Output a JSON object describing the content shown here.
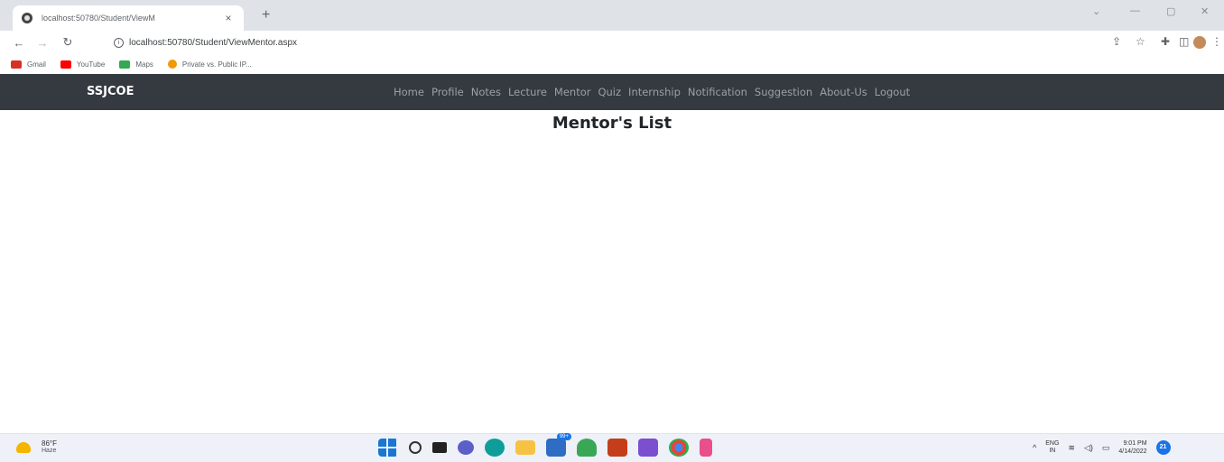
{
  "browser": {
    "tab_title": "localhost:50780/Student/ViewM",
    "tab_close": "×",
    "new_tab": "+",
    "url": "localhost:50780/Student/ViewMentor.aspx",
    "bookmarks": [
      {
        "label": "Gmail",
        "color": "#d93025"
      },
      {
        "label": "YouTube",
        "color": "#ff0000"
      },
      {
        "label": "Maps",
        "color": "#34a853"
      },
      {
        "label": "Private vs. Public IP...",
        "color": "#f29900"
      }
    ]
  },
  "site": {
    "brand": "SSJCOE",
    "nav": [
      "Home",
      "Profile",
      "Notes",
      "Lecture",
      "Mentor",
      "Quiz",
      "Internship",
      "Notification",
      "Suggestion",
      "About-Us",
      "Logout"
    ],
    "page_title": "Mentor's List"
  },
  "taskbar": {
    "temp": "86°F",
    "condition": "Haze",
    "badge": "99+",
    "lang_top": "ENG",
    "lang_bottom": "IN",
    "time": "9:01 PM",
    "date": "4/14/2022",
    "notifications": "21"
  }
}
